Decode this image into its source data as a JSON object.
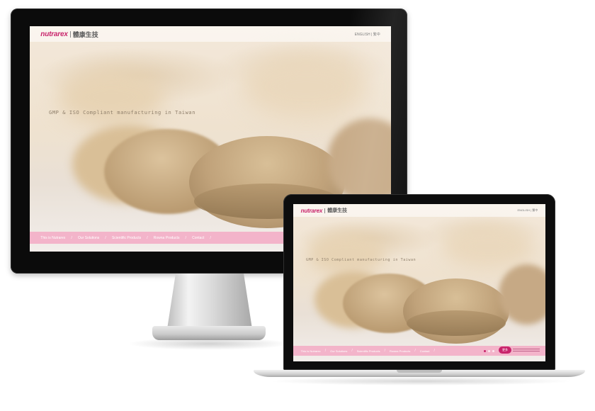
{
  "site": {
    "logo_word": "nutrarex",
    "logo_cn": "體康生技",
    "lang_switch": "ENGLISH | 繁中",
    "tagline": "GMP & ISO Compliant manufacturing in Taiwan",
    "nav": {
      "item1": "This is Nutrarex",
      "item2": "Our Solutions",
      "item3": "Scientific Products",
      "item4": "Rowna Products",
      "item5": "Contact"
    },
    "badge": "更多"
  },
  "colors": {
    "brand": "#c8246b",
    "navbar": "#f3aac4",
    "tablet": "#c9ad84"
  },
  "icons": [
    "slider-dot-icon",
    "badge-icon"
  ]
}
